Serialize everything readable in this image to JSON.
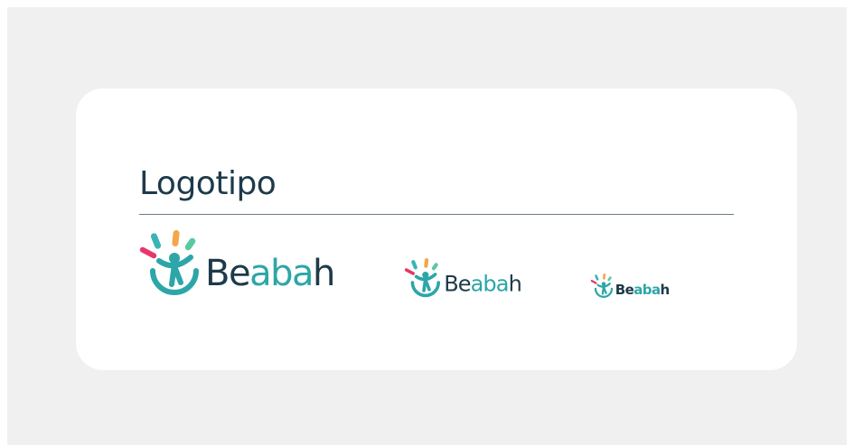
{
  "section": {
    "title": "Logotipo"
  },
  "brand": {
    "wordmark": "Beabah",
    "wordmark_parts": [
      "Be",
      "aba",
      "h"
    ],
    "logo_variants": [
      "large",
      "medium",
      "small"
    ]
  },
  "colors": {
    "page_background": "#f0f0f0",
    "card_background": "#ffffff",
    "title": "#1e3a4a",
    "rule": "#6d7b85",
    "wordmark_dark": "#1e3a4a",
    "wordmark_teal": "#2ca6a8",
    "icon_teal": "#2ca6a8",
    "ray_pink": "#e8356a",
    "ray_teal": "#3bb3b6",
    "ray_orange": "#f3a64a",
    "ray_green": "#5bc9a0"
  }
}
